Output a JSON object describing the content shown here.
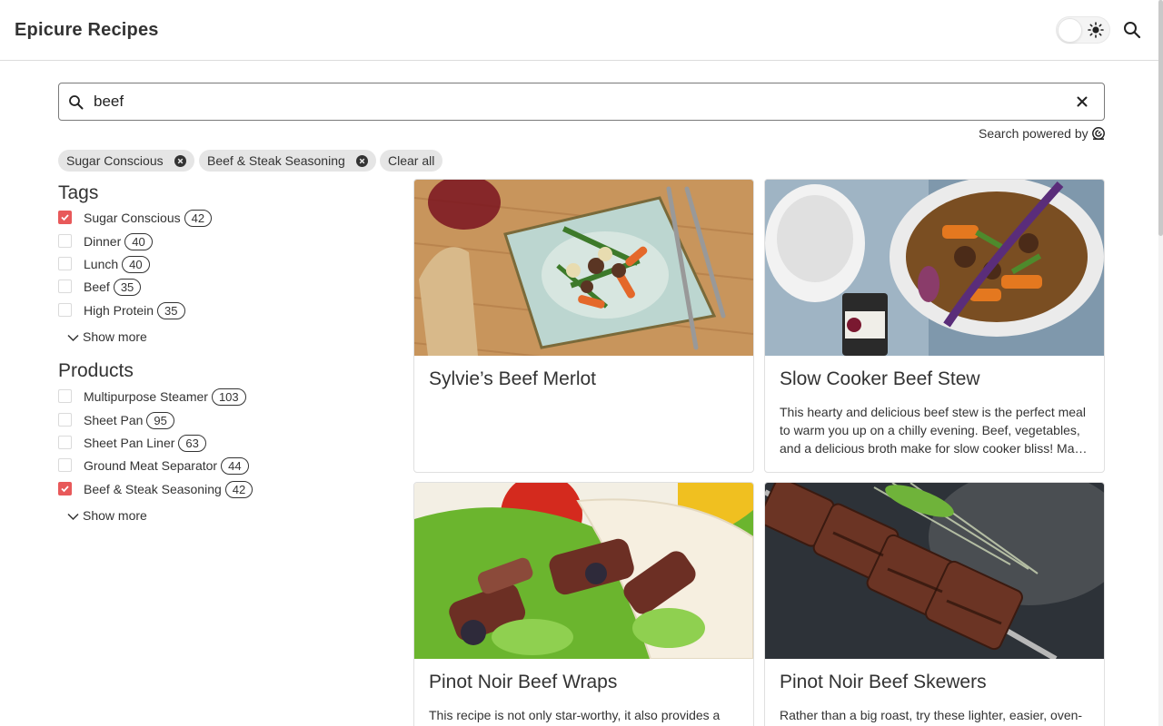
{
  "header": {
    "title": "Epicure Recipes",
    "theme_toggle_icon": "sun-icon",
    "search_icon": "search-icon"
  },
  "search": {
    "value": "beef",
    "placeholder": "",
    "powered_by": "Search powered by"
  },
  "refinements": {
    "chips": [
      {
        "label": "Sugar Conscious"
      },
      {
        "label": "Beef & Steak Seasoning"
      }
    ],
    "clear_all": "Clear all"
  },
  "facets": {
    "tags": {
      "title": "Tags",
      "items": [
        {
          "label": "Sugar Conscious",
          "count": "42",
          "checked": true
        },
        {
          "label": "Dinner",
          "count": "40",
          "checked": false
        },
        {
          "label": "Lunch",
          "count": "40",
          "checked": false
        },
        {
          "label": "Beef",
          "count": "35",
          "checked": false
        },
        {
          "label": "High Protein",
          "count": "35",
          "checked": false
        }
      ],
      "show_more": "Show more"
    },
    "products": {
      "title": "Products",
      "items": [
        {
          "label": "Multipurpose Steamer",
          "count": "103",
          "checked": false
        },
        {
          "label": "Sheet Pan",
          "count": "95",
          "checked": false
        },
        {
          "label": "Sheet Pan Liner",
          "count": "63",
          "checked": false
        },
        {
          "label": "Ground Meat Separator",
          "count": "44",
          "checked": false
        },
        {
          "label": "Beef & Steak Seasoning",
          "count": "42",
          "checked": true
        }
      ],
      "show_more": "Show more"
    }
  },
  "results": [
    {
      "title": "Sylvie’s Beef Merlot",
      "description": ""
    },
    {
      "title": "Slow Cooker Beef Stew",
      "description": "This hearty and delicious beef stew is the perfect meal to warm you up on a chilly evening. Beef, vegetables, and a delicious broth make for slow cooker bliss! Ma…"
    },
    {
      "title": "Pinot Noir Beef Wraps",
      "description": "This recipe is not only star-worthy, it also provides a"
    },
    {
      "title": "Pinot Noir Beef Skewers",
      "description": "Rather than a big roast, try these lighter, easier, oven-"
    }
  ],
  "colors": {
    "accent": "#e8595a",
    "chip_bg": "#e5e5e5",
    "border": "#e0e0e0"
  }
}
